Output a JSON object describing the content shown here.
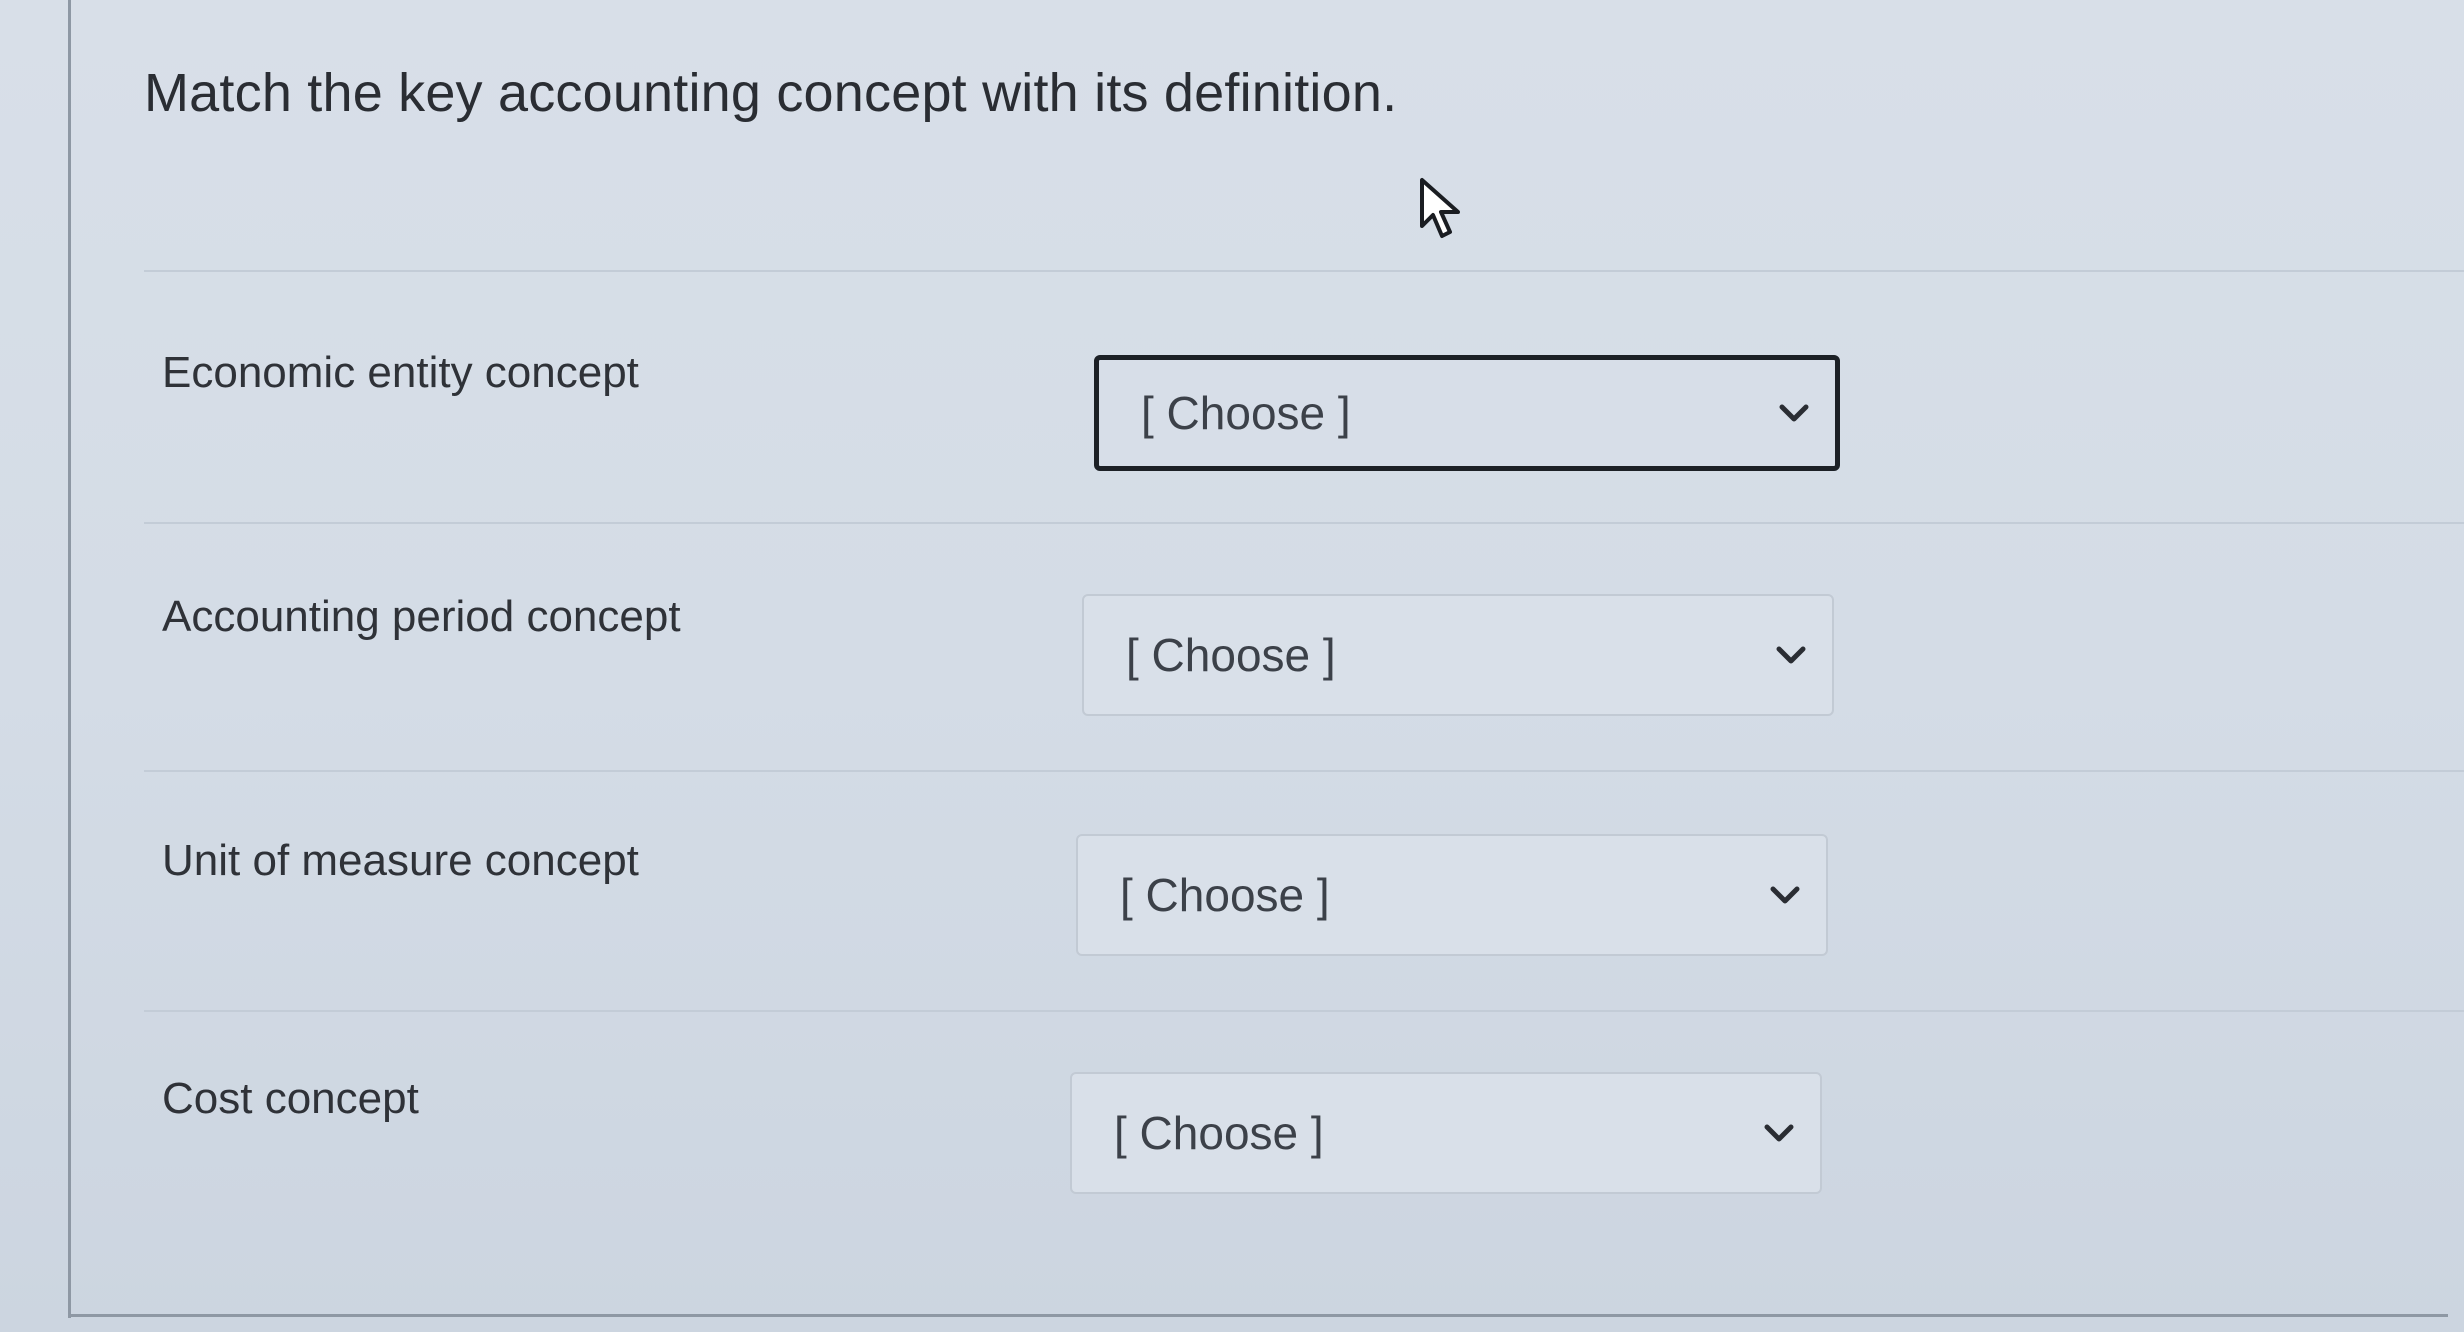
{
  "question": {
    "title": "Match the key accounting concept with its definition."
  },
  "rows": [
    {
      "label": "Economic entity concept",
      "select_value": "[ Choose ]"
    },
    {
      "label": "Accounting period concept",
      "select_value": "[ Choose ]"
    },
    {
      "label": "Unit of measure concept",
      "select_value": "[ Choose ]"
    },
    {
      "label": "Cost concept",
      "select_value": "[ Choose ]"
    }
  ],
  "icons": {
    "cursor": "mouse-pointer-icon",
    "dropdown": "chevron-down-icon"
  },
  "colors": {
    "background": "#d4dce6",
    "focus_border": "#1c2026",
    "text": "#2f3238"
  }
}
